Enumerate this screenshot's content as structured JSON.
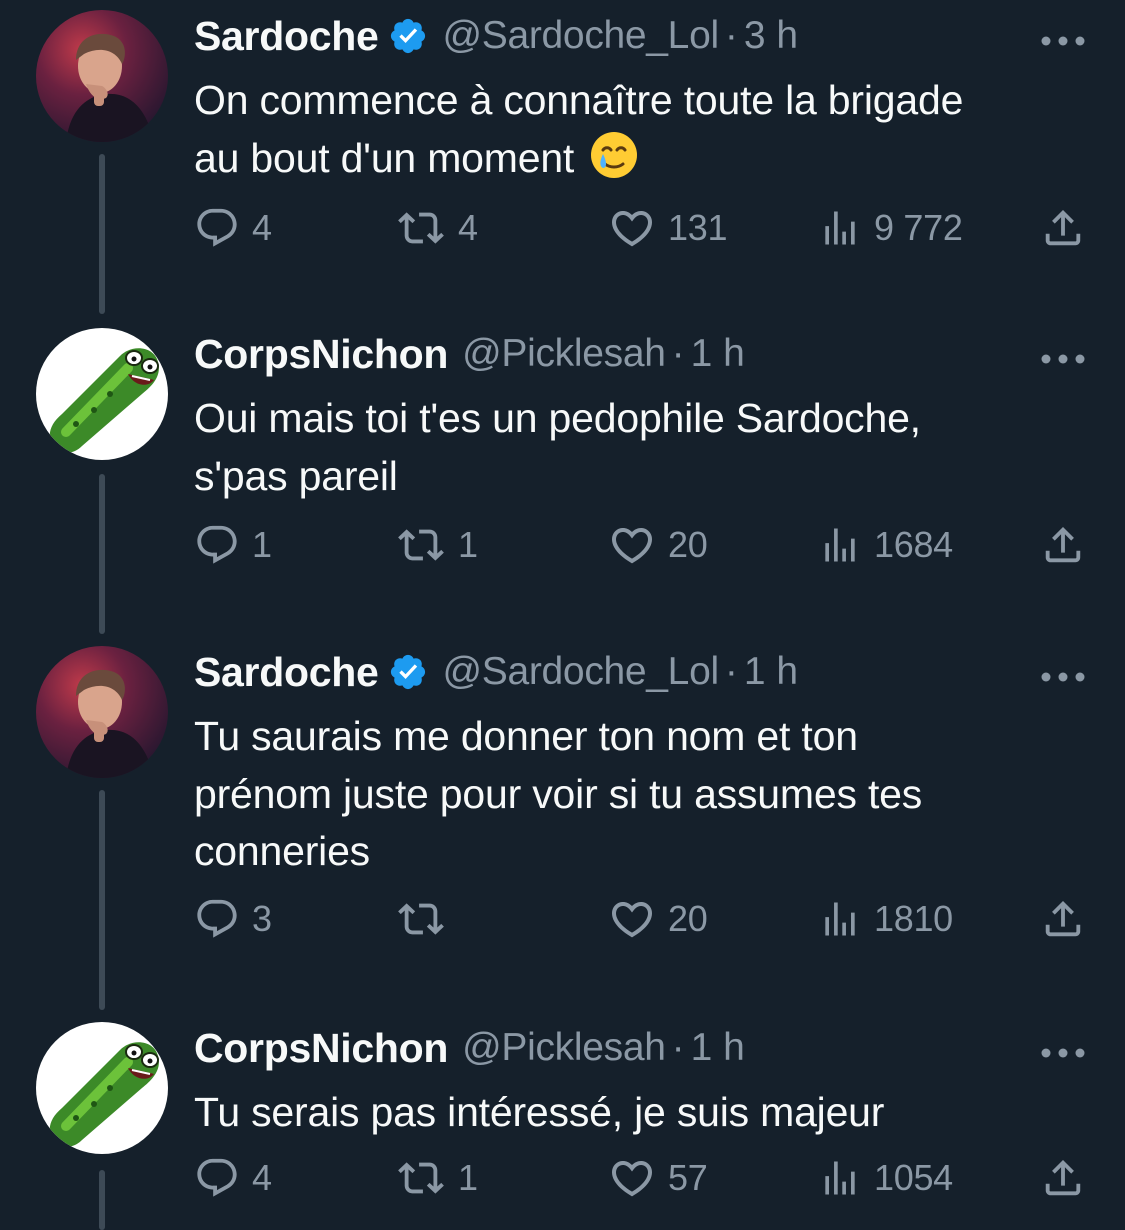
{
  "tweets": [
    {
      "name": "Sardoche",
      "verified": true,
      "handle": "@Sardoche_Lol",
      "separator": "·",
      "time": "3 h",
      "lines": [
        "On commence à connaître toute la brigade",
        "au bout d'un moment"
      ],
      "emoji": "smiling-face-with-tear-icon",
      "avatar": "sardoche-avatar",
      "replies": "4",
      "retweets": "4",
      "likes": "131",
      "views": "9 772"
    },
    {
      "name": "CorpsNichon",
      "verified": false,
      "handle": "@Picklesah",
      "separator": "·",
      "time": "1 h",
      "lines": [
        "Oui mais toi t'es un pedophile Sardoche,",
        "s'pas pareil"
      ],
      "avatar": "pickle-rick-avatar",
      "replies": "1",
      "retweets": "1",
      "likes": "20",
      "views": "1684"
    },
    {
      "name": "Sardoche",
      "verified": true,
      "handle": "@Sardoche_Lol",
      "separator": "·",
      "time": "1 h",
      "lines": [
        "Tu saurais me donner ton nom et ton",
        "prénom juste pour voir si tu assumes tes",
        "conneries"
      ],
      "avatar": "sardoche-avatar",
      "replies": "3",
      "retweets": "",
      "likes": "20",
      "views": "1810"
    },
    {
      "name": "CorpsNichon",
      "verified": false,
      "handle": "@Picklesah",
      "separator": "·",
      "time": "1 h",
      "lines": [
        "Tu serais pas intéressé, je suis majeur"
      ],
      "avatar": "pickle-rick-avatar",
      "replies": "4",
      "retweets": "1",
      "likes": "57",
      "views": "1054"
    }
  ],
  "colors": {
    "background": "#15202b",
    "text": "#f7f9f9",
    "secondary": "#8b98a5",
    "verified": "#1d9bf0",
    "thread_line": "#3d4a56"
  },
  "icons": {
    "reply": "reply-icon",
    "retweet": "retweet-icon",
    "like": "heart-icon",
    "views": "views-icon",
    "share": "share-icon",
    "more": "more-icon"
  }
}
